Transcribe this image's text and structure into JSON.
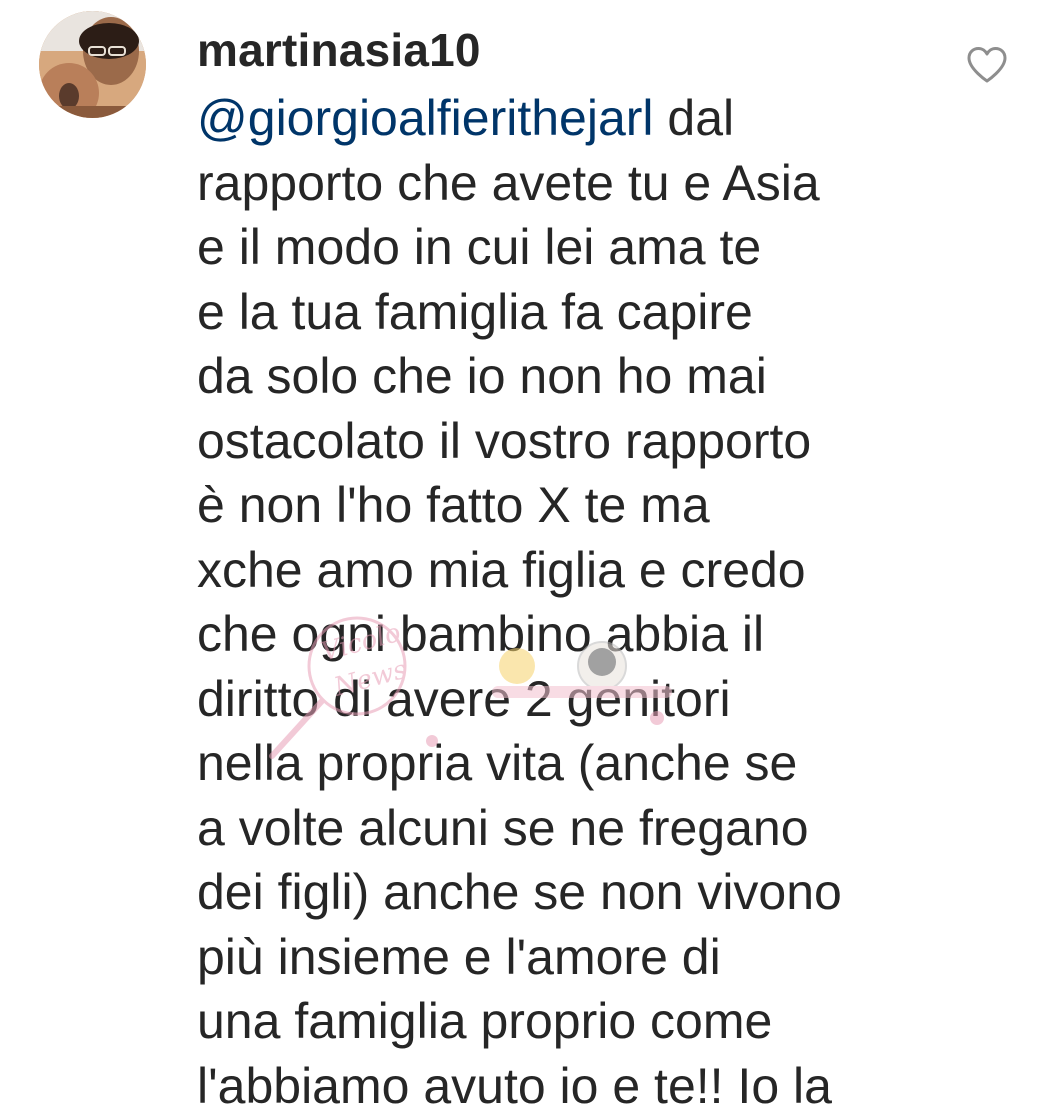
{
  "comment": {
    "username": "martinasia10",
    "mention": "@giorgioalfierithejarl",
    "text": "  dal\nrapporto che avete tu e Asia\ne il modo in cui lei ama te\ne la tua famiglia fa capire\nda solo che io non ho mai\nostacolato il vostro rapporto\nè non l'ho fatto X te ma\nxche amo mia figlia e credo\nche ogni bambino abbia il\ndiritto di avere 2 genitori\nnella propria vita (anche se\na volte alcuni se ne fregano\ndei figli) anche  se non vivono\npiù insieme e l'amore di\nuna famiglia proprio come\nl'abbiamo avuto io e te!! Io la"
  },
  "icons": {
    "avatar": "profile-photo",
    "like": "heart-outline-icon"
  },
  "watermark": {
    "text": "Vicolo News"
  },
  "colors": {
    "text": "#262626",
    "mention": "#003569",
    "icon": "#8e8e8e",
    "watermark": "#e8a0b8"
  }
}
